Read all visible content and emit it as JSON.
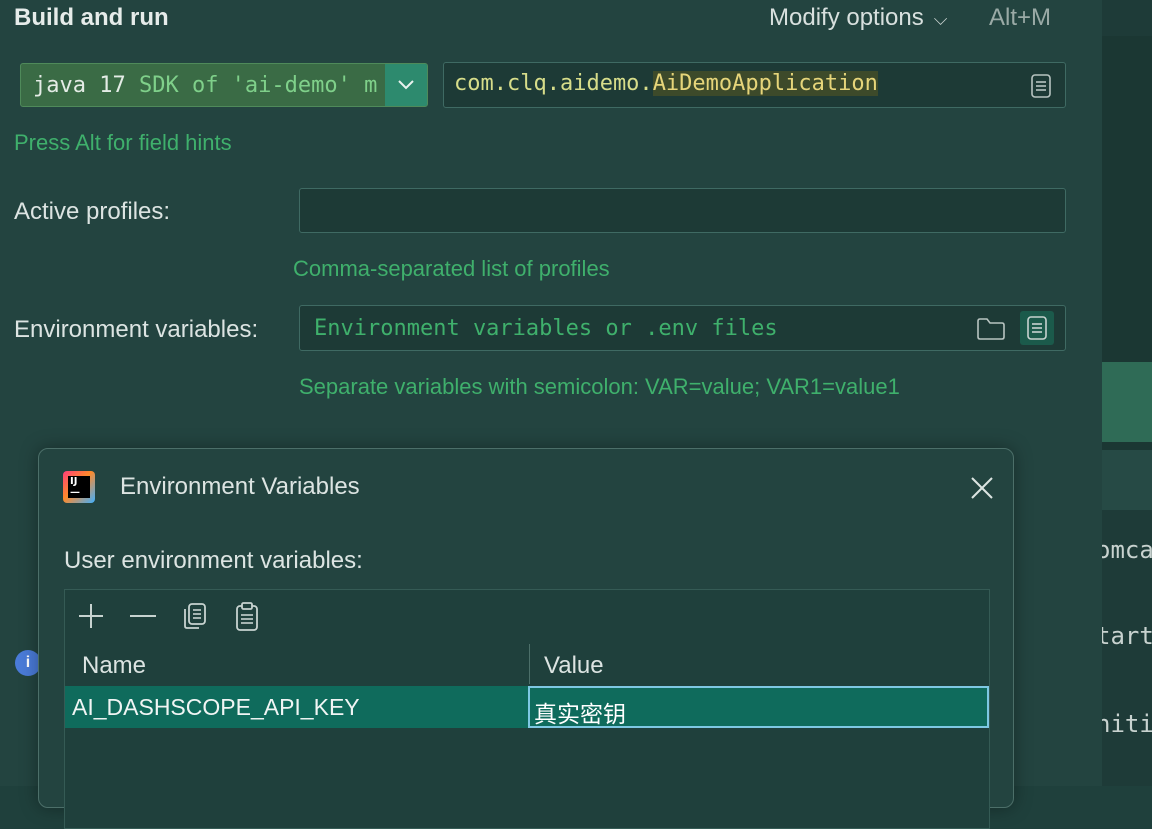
{
  "header": {
    "title": "Build and run",
    "modify_options": "Modify options",
    "modify_shortcut": "Alt+M"
  },
  "run_config": {
    "sdk_main": "java 17",
    "sdk_detail": "SDK of 'ai-demo' m",
    "main_class_prefix": "com.clq.aidemo.",
    "main_class_name": "AiDemoApplication",
    "field_hints": "Press Alt for field hints"
  },
  "profiles": {
    "label": "Active profiles:",
    "value": "",
    "hint": "Comma-separated list of profiles"
  },
  "env": {
    "label": "Environment variables:",
    "placeholder": "Environment variables or .env files",
    "hint": "Separate variables with semicolon: VAR=value; VAR1=value1"
  },
  "right_strip": {
    "lines": [
      "omca",
      "tart",
      "nitia"
    ]
  },
  "dialog": {
    "title": "Environment Variables",
    "section_label": "User environment variables:",
    "columns": [
      "Name",
      "Value"
    ],
    "rows": [
      {
        "name": "AI_DASHSCOPE_API_KEY",
        "value": "真实密钥"
      }
    ],
    "logo_text": "IJ"
  },
  "colors": {
    "background": "#234440",
    "accent_green": "#3fb06c",
    "selection": "#0f6b5c",
    "focus_border": "#7ec8e3"
  }
}
